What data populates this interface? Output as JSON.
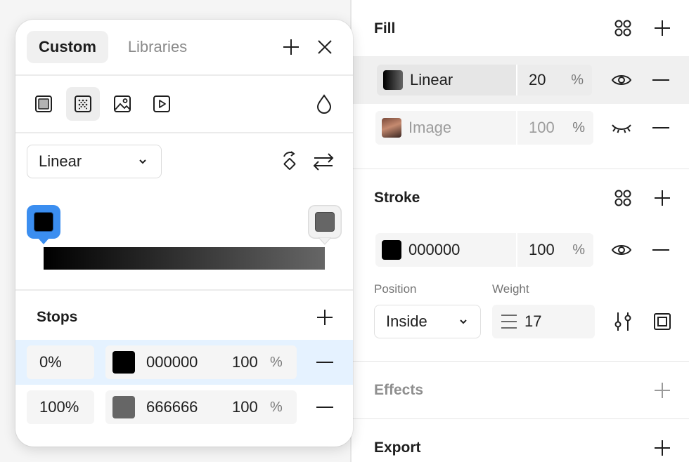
{
  "panel": {
    "fill": {
      "title": "Fill",
      "layers": [
        {
          "name": "Linear",
          "opacity": "20",
          "unit": "%",
          "visible": true
        },
        {
          "name": "Image",
          "opacity": "100",
          "unit": "%",
          "visible": false
        }
      ]
    },
    "stroke": {
      "title": "Stroke",
      "color_hex": "000000",
      "opacity": "100",
      "unit": "%",
      "position_label": "Position",
      "position_value": "Inside",
      "weight_label": "Weight",
      "weight_value": "17"
    },
    "effects": {
      "title": "Effects"
    },
    "export": {
      "title": "Export"
    }
  },
  "picker": {
    "tabs": [
      {
        "label": "Custom",
        "active": true
      },
      {
        "label": "Libraries",
        "active": false
      }
    ],
    "paint_types": [
      "solid-paint-icon",
      "gradient-paint-icon",
      "image-paint-icon",
      "video-paint-icon"
    ],
    "gradient_type": "Linear",
    "stops_title": "Stops",
    "stops": [
      {
        "position": "0%",
        "hex": "000000",
        "opacity": "100",
        "unit": "%",
        "color": "#000000",
        "selected": true
      },
      {
        "position": "100%",
        "hex": "666666",
        "opacity": "100",
        "unit": "%",
        "color": "#666666",
        "selected": false
      }
    ]
  },
  "colors": {
    "accent": "#3b8ef0",
    "selected_row": "#e5f2ff",
    "stop_0": "#000000",
    "stop_1": "#666666"
  }
}
